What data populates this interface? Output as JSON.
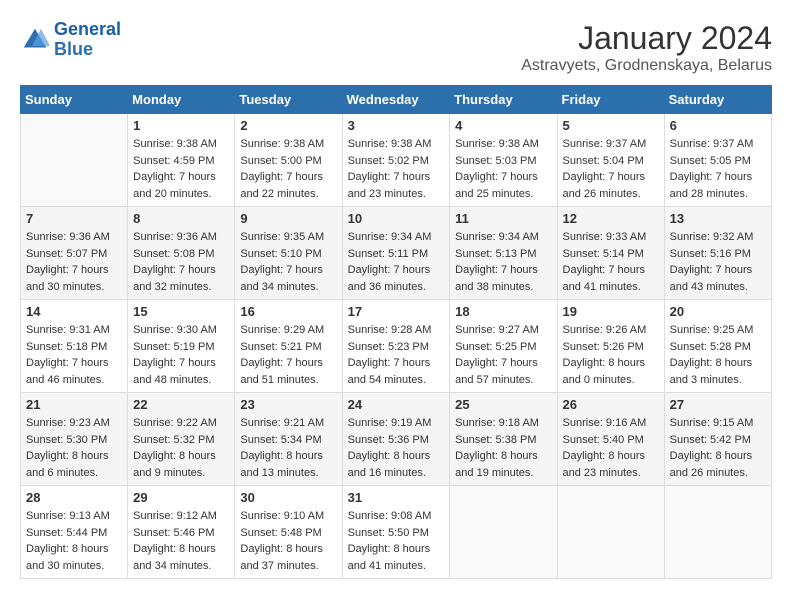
{
  "logo": {
    "text_general": "General",
    "text_blue": "Blue"
  },
  "title": "January 2024",
  "subtitle": "Astravyets, Grodnenskaya, Belarus",
  "days_of_week": [
    "Sunday",
    "Monday",
    "Tuesday",
    "Wednesday",
    "Thursday",
    "Friday",
    "Saturday"
  ],
  "weeks": [
    [
      {
        "day": "",
        "info": ""
      },
      {
        "day": "1",
        "info": "Sunrise: 9:38 AM\nSunset: 4:59 PM\nDaylight: 7 hours\nand 20 minutes."
      },
      {
        "day": "2",
        "info": "Sunrise: 9:38 AM\nSunset: 5:00 PM\nDaylight: 7 hours\nand 22 minutes."
      },
      {
        "day": "3",
        "info": "Sunrise: 9:38 AM\nSunset: 5:02 PM\nDaylight: 7 hours\nand 23 minutes."
      },
      {
        "day": "4",
        "info": "Sunrise: 9:38 AM\nSunset: 5:03 PM\nDaylight: 7 hours\nand 25 minutes."
      },
      {
        "day": "5",
        "info": "Sunrise: 9:37 AM\nSunset: 5:04 PM\nDaylight: 7 hours\nand 26 minutes."
      },
      {
        "day": "6",
        "info": "Sunrise: 9:37 AM\nSunset: 5:05 PM\nDaylight: 7 hours\nand 28 minutes."
      }
    ],
    [
      {
        "day": "7",
        "info": "Sunrise: 9:36 AM\nSunset: 5:07 PM\nDaylight: 7 hours\nand 30 minutes."
      },
      {
        "day": "8",
        "info": "Sunrise: 9:36 AM\nSunset: 5:08 PM\nDaylight: 7 hours\nand 32 minutes."
      },
      {
        "day": "9",
        "info": "Sunrise: 9:35 AM\nSunset: 5:10 PM\nDaylight: 7 hours\nand 34 minutes."
      },
      {
        "day": "10",
        "info": "Sunrise: 9:34 AM\nSunset: 5:11 PM\nDaylight: 7 hours\nand 36 minutes."
      },
      {
        "day": "11",
        "info": "Sunrise: 9:34 AM\nSunset: 5:13 PM\nDaylight: 7 hours\nand 38 minutes."
      },
      {
        "day": "12",
        "info": "Sunrise: 9:33 AM\nSunset: 5:14 PM\nDaylight: 7 hours\nand 41 minutes."
      },
      {
        "day": "13",
        "info": "Sunrise: 9:32 AM\nSunset: 5:16 PM\nDaylight: 7 hours\nand 43 minutes."
      }
    ],
    [
      {
        "day": "14",
        "info": "Sunrise: 9:31 AM\nSunset: 5:18 PM\nDaylight: 7 hours\nand 46 minutes."
      },
      {
        "day": "15",
        "info": "Sunrise: 9:30 AM\nSunset: 5:19 PM\nDaylight: 7 hours\nand 48 minutes."
      },
      {
        "day": "16",
        "info": "Sunrise: 9:29 AM\nSunset: 5:21 PM\nDaylight: 7 hours\nand 51 minutes."
      },
      {
        "day": "17",
        "info": "Sunrise: 9:28 AM\nSunset: 5:23 PM\nDaylight: 7 hours\nand 54 minutes."
      },
      {
        "day": "18",
        "info": "Sunrise: 9:27 AM\nSunset: 5:25 PM\nDaylight: 7 hours\nand 57 minutes."
      },
      {
        "day": "19",
        "info": "Sunrise: 9:26 AM\nSunset: 5:26 PM\nDaylight: 8 hours\nand 0 minutes."
      },
      {
        "day": "20",
        "info": "Sunrise: 9:25 AM\nSunset: 5:28 PM\nDaylight: 8 hours\nand 3 minutes."
      }
    ],
    [
      {
        "day": "21",
        "info": "Sunrise: 9:23 AM\nSunset: 5:30 PM\nDaylight: 8 hours\nand 6 minutes."
      },
      {
        "day": "22",
        "info": "Sunrise: 9:22 AM\nSunset: 5:32 PM\nDaylight: 8 hours\nand 9 minutes."
      },
      {
        "day": "23",
        "info": "Sunrise: 9:21 AM\nSunset: 5:34 PM\nDaylight: 8 hours\nand 13 minutes."
      },
      {
        "day": "24",
        "info": "Sunrise: 9:19 AM\nSunset: 5:36 PM\nDaylight: 8 hours\nand 16 minutes."
      },
      {
        "day": "25",
        "info": "Sunrise: 9:18 AM\nSunset: 5:38 PM\nDaylight: 8 hours\nand 19 minutes."
      },
      {
        "day": "26",
        "info": "Sunrise: 9:16 AM\nSunset: 5:40 PM\nDaylight: 8 hours\nand 23 minutes."
      },
      {
        "day": "27",
        "info": "Sunrise: 9:15 AM\nSunset: 5:42 PM\nDaylight: 8 hours\nand 26 minutes."
      }
    ],
    [
      {
        "day": "28",
        "info": "Sunrise: 9:13 AM\nSunset: 5:44 PM\nDaylight: 8 hours\nand 30 minutes."
      },
      {
        "day": "29",
        "info": "Sunrise: 9:12 AM\nSunset: 5:46 PM\nDaylight: 8 hours\nand 34 minutes."
      },
      {
        "day": "30",
        "info": "Sunrise: 9:10 AM\nSunset: 5:48 PM\nDaylight: 8 hours\nand 37 minutes."
      },
      {
        "day": "31",
        "info": "Sunrise: 9:08 AM\nSunset: 5:50 PM\nDaylight: 8 hours\nand 41 minutes."
      },
      {
        "day": "",
        "info": ""
      },
      {
        "day": "",
        "info": ""
      },
      {
        "day": "",
        "info": ""
      }
    ]
  ]
}
